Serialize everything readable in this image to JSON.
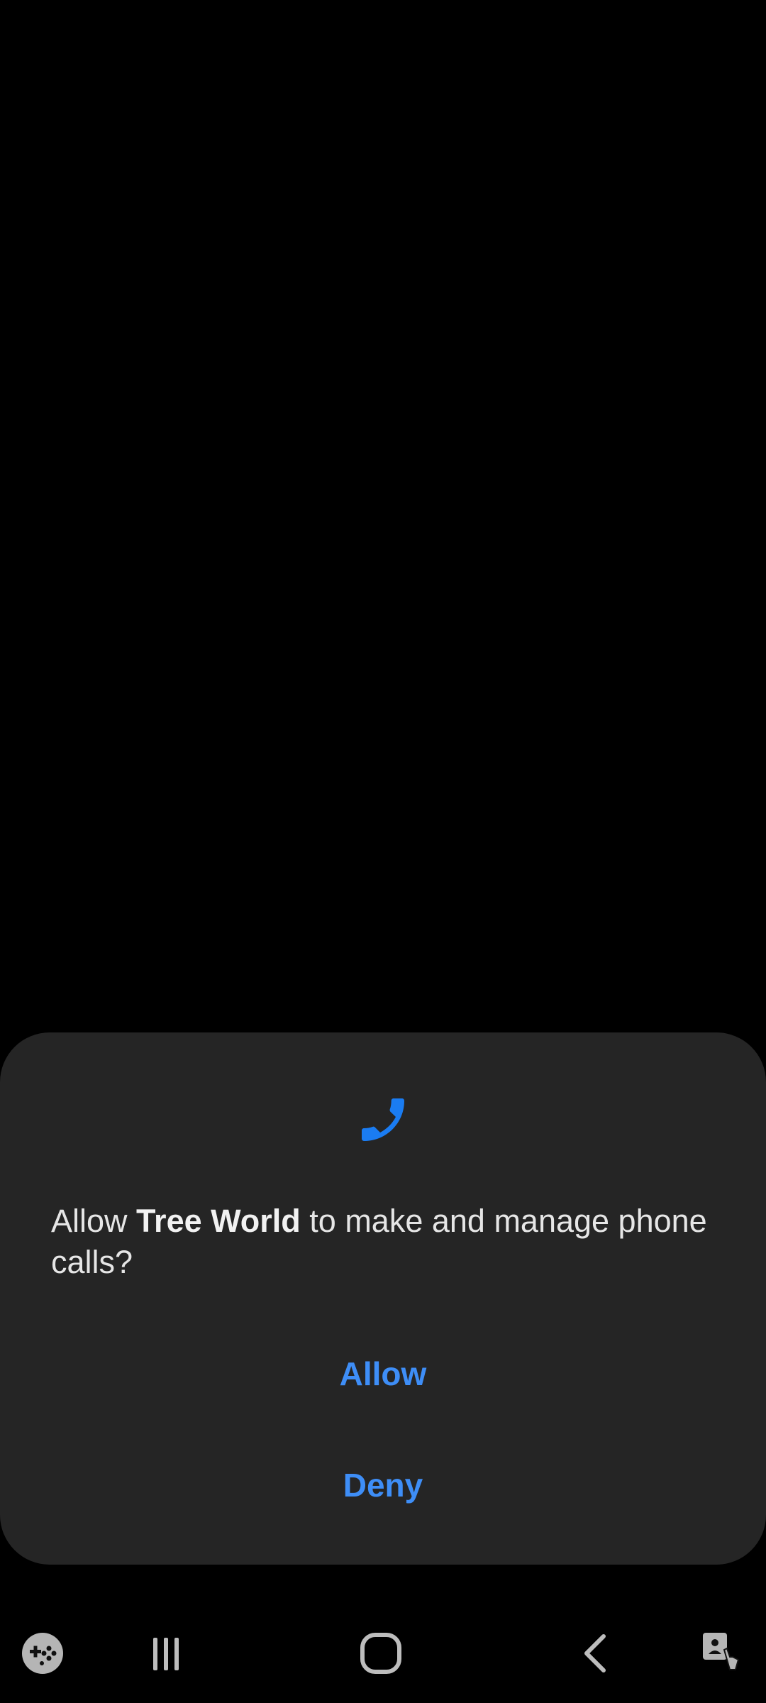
{
  "dialog": {
    "icon": "phone-icon",
    "message_prefix": "Allow ",
    "app_name": "Tree World",
    "message_suffix": " to make and manage phone calls?",
    "allow_label": "Allow",
    "deny_label": "Deny"
  },
  "navbar": {
    "items": [
      {
        "icon": "game-tools-icon"
      },
      {
        "icon": "recent-apps-icon"
      },
      {
        "icon": "home-icon"
      },
      {
        "icon": "back-icon"
      },
      {
        "icon": "accessibility-touch-icon"
      }
    ]
  },
  "colors": {
    "accent": "#3e8ef7",
    "dialog_bg": "#252525",
    "background": "#000000",
    "text": "#e6e6e6"
  }
}
